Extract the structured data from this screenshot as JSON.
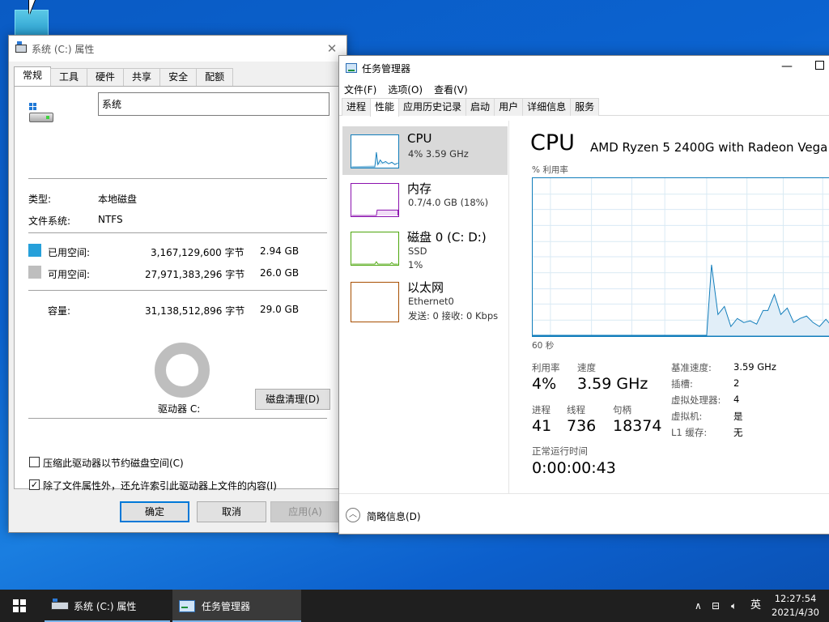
{
  "props": {
    "title": "系统 (C:) 属性",
    "tabs": [
      "常规",
      "工具",
      "硬件",
      "共享",
      "安全",
      "配额"
    ],
    "name_value": "系统",
    "type_label": "类型:",
    "type_value": "本地磁盘",
    "fs_label": "文件系统:",
    "fs_value": "NTFS",
    "used_label": "已用空间:",
    "used_bytes": "3,167,129,600 字节",
    "used_size": "2.94 GB",
    "free_label": "可用空间:",
    "free_bytes": "27,971,383,296 字节",
    "free_size": "26.0 GB",
    "cap_label": "容量:",
    "cap_bytes": "31,138,512,896 字节",
    "cap_size": "29.0 GB",
    "used_fraction": 0.102,
    "drive_label": "驱动器 C:",
    "cleanup_button": "磁盘清理(D)",
    "compress_label": "压缩此驱动器以节约磁盘空间(C)",
    "index_label": "除了文件属性外，还允许索引此驱动器上文件的内容(I)",
    "index_checked": "✓",
    "ok_button": "确定",
    "cancel_button": "取消",
    "apply_button": "应用(A)",
    "used_color": "#26a0da",
    "free_color": "#bebebe"
  },
  "tm": {
    "title": "任务管理器",
    "menu": [
      "文件(F)",
      "选项(O)",
      "查看(V)"
    ],
    "tabs": [
      "进程",
      "性能",
      "应用历史记录",
      "启动",
      "用户",
      "详细信息",
      "服务"
    ],
    "side": {
      "cpu": {
        "title": "CPU",
        "sub": "4% 3.59 GHz"
      },
      "mem": {
        "title": "内存",
        "sub": "0.7/4.0 GB (18%)"
      },
      "disk": {
        "title": "磁盘 0 (C: D:)",
        "sub1": "SSD",
        "sub2": "1%"
      },
      "net": {
        "title": "以太网",
        "sub1": "Ethernet0",
        "sub2": "发送: 0 接收: 0 Kbps"
      }
    },
    "heading": "CPU",
    "model": "AMD Ryzen 5 2400G with Radeon Vega",
    "graph_top_label": "% 利用率",
    "graph_bottom_label": "60 秒",
    "stats": {
      "util_label": "利用率",
      "util_value": "4%",
      "speed_label": "速度",
      "speed_value": "3.59 GHz",
      "proc_label": "进程",
      "proc_value": "41",
      "threads_label": "线程",
      "threads_value": "736",
      "handles_label": "句柄",
      "handles_value": "18374",
      "uptime_label": "正常运行时间",
      "uptime_value": "0:00:00:43"
    },
    "specs": [
      {
        "k": "基准速度:",
        "v": "3.59 GHz"
      },
      {
        "k": "插槽:",
        "v": "2"
      },
      {
        "k": "虚拟处理器:",
        "v": "4"
      },
      {
        "k": "虚拟机:",
        "v": "是"
      },
      {
        "k": "L1 缓存:",
        "v": "无"
      }
    ],
    "footer_label": "简略信息(D)"
  },
  "taskbar": {
    "items": [
      {
        "label": "系统 (C:) 属性"
      },
      {
        "label": "任务管理器"
      }
    ],
    "ime": "英",
    "time": "12:27:54",
    "date": "2021/4/30"
  }
}
